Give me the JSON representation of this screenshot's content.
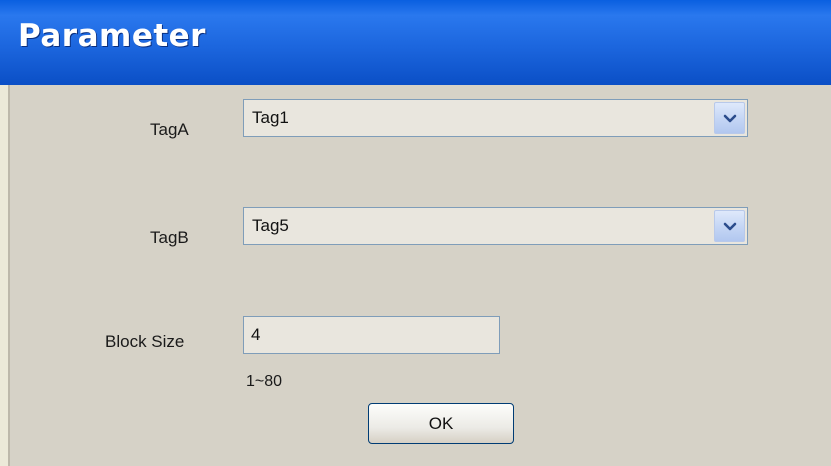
{
  "dialog": {
    "title": "Parameter"
  },
  "fields": {
    "tag_a": {
      "label": "TagA",
      "value": "Tag1"
    },
    "tag_b": {
      "label": "TagB",
      "value": "Tag5"
    },
    "block_size": {
      "label": "Block Size",
      "value": "4",
      "range_hint": "1~80"
    }
  },
  "buttons": {
    "ok_label": "OK"
  },
  "icons": {
    "dropdown": "chevron-down-icon"
  },
  "colors": {
    "titlebar": "#1c66de",
    "body": "#d6d2c7",
    "field_background": "#e9e6de",
    "field_border": "#7f9db9"
  }
}
